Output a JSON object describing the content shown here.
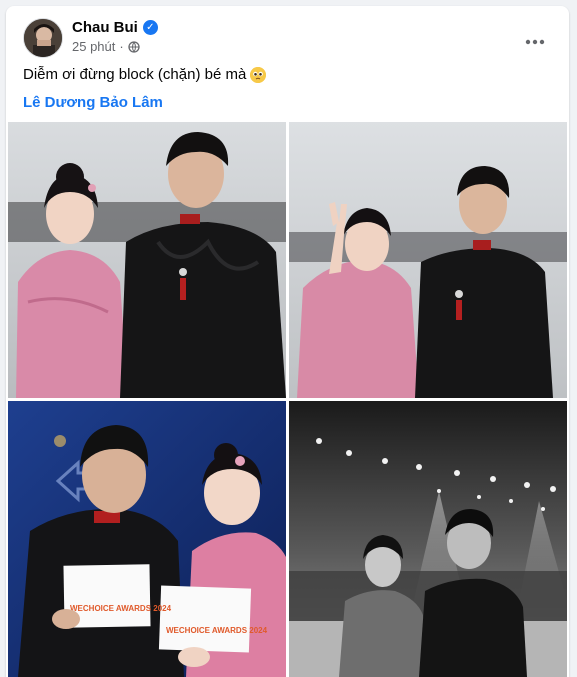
{
  "post": {
    "author": "Chau Bui",
    "time": "25 phút",
    "separator": "·",
    "caption": "Diễm ơi đừng block (chặn) bé mà",
    "tag": "Lê Dương Bảo Lâm"
  },
  "icons": {
    "verified": "verified-badge-icon",
    "audience": "globe-icon",
    "more": "more-options-icon",
    "emoji": "pleading-face-emoji"
  },
  "photos": [
    {
      "kind": "color-portrait"
    },
    {
      "kind": "color-portrait-peace-sign"
    },
    {
      "kind": "award-envelopes",
      "envelope_text": "WECHOICE AWARDS 2024"
    },
    {
      "kind": "grayscale-stage"
    }
  ],
  "colors": {
    "link": "#1877f2",
    "text": "#050505",
    "secondary": "#65676b"
  }
}
